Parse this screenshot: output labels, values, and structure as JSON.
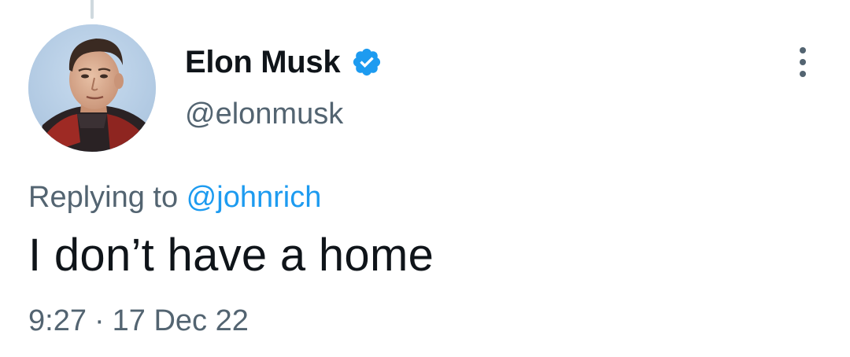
{
  "tweet": {
    "author": {
      "display_name": "Elon Musk",
      "handle": "@elonmusk",
      "verified": true,
      "verified_icon": "verified-badge-icon",
      "avatar": "profile-photo"
    },
    "more_icon": "more-options-icon",
    "reply": {
      "prefix": "Replying to",
      "target": "@johnrich"
    },
    "text": "I don’t have a home",
    "time": "9:27",
    "separator": "·",
    "date": "17 Dec 22"
  },
  "colors": {
    "link": "#1d9bf0",
    "primary_text": "#0f1419",
    "secondary_text": "#536471",
    "thread_line": "#cfd9de"
  }
}
